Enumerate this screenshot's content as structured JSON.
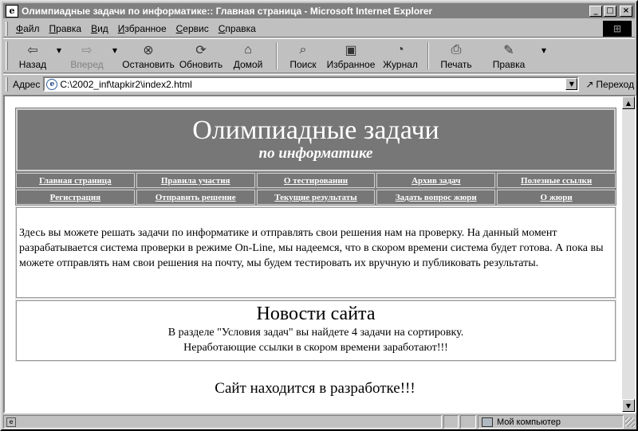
{
  "window": {
    "title": "Олимпиадные задачи по информатике:: Главная страница - Microsoft Internet Explorer",
    "buttons": {
      "minimize": "_",
      "maximize": "□",
      "close": "×"
    }
  },
  "menu": [
    "Файл",
    "Правка",
    "Вид",
    "Избранное",
    "Сервис",
    "Справка"
  ],
  "toolbar": {
    "back": "Назад",
    "forward": "Вперед",
    "stop": "Остановить",
    "refresh": "Обновить",
    "home": "Домой",
    "search": "Поиск",
    "favorites": "Избранное",
    "history": "Журнал",
    "print": "Печать",
    "edit": "Правка"
  },
  "address": {
    "label": "Адрес",
    "url": "C:\\2002_inf\\tapkir2\\index2.html",
    "go": "Переход"
  },
  "page": {
    "banner_title": "Олимпиадные задачи",
    "banner_subtitle": "по информатике",
    "nav": [
      "Главная страница",
      "Правила участия",
      "О тестировании",
      "Архив задач",
      "Полезные ссылки",
      "Регистрация",
      "Отправить решение",
      "Текущие результаты",
      "Задать вопрос жюри",
      "О жюри"
    ],
    "intro": "Здесь вы можете решать задачи по информатике и отправлять свои решения нам на проверку. На данный момент разрабатывается система проверки в режиме On-Line, мы надеемся, что в скором времени система будет готова. А пока вы можете отправлять нам свои решения на почту, мы будем тестировать их вручную и публиковать результаты.",
    "news_title": "Новости сайта",
    "news": [
      "В разделе \"Условия задач\" вы найдете 4 задачи на сортировку.",
      "Неработающие ссылки в скором времени заработают!!!"
    ],
    "dev_note": "Сайт находится в разработке!!!"
  },
  "status": {
    "zone": "Мой компьютер"
  }
}
